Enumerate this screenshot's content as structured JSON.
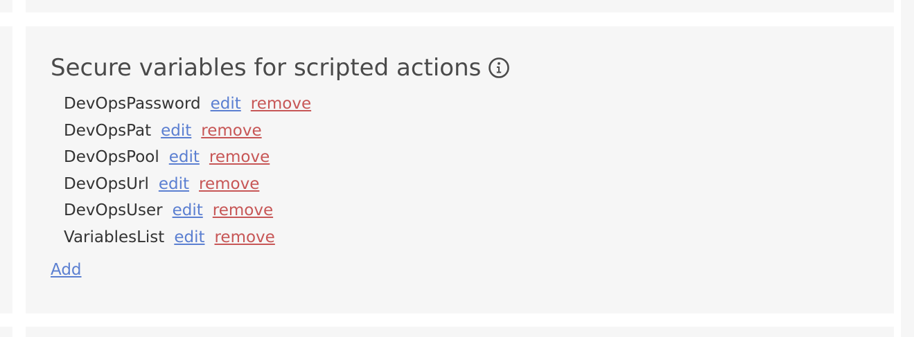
{
  "section": {
    "title": "Secure variables for scripted actions",
    "info_icon": "info-circle-icon",
    "edit_label": "edit",
    "remove_label": "remove",
    "add_label": "Add",
    "variables": [
      {
        "name": "DevOpsPassword"
      },
      {
        "name": "DevOpsPat"
      },
      {
        "name": "DevOpsPool"
      },
      {
        "name": "DevOpsUrl"
      },
      {
        "name": "DevOpsUser"
      },
      {
        "name": "VariablesList"
      }
    ]
  },
  "colors": {
    "panel_background": "#f6f6f6",
    "link_blue": "#5b7fd1",
    "link_red": "#c75656",
    "text": "#333333"
  }
}
